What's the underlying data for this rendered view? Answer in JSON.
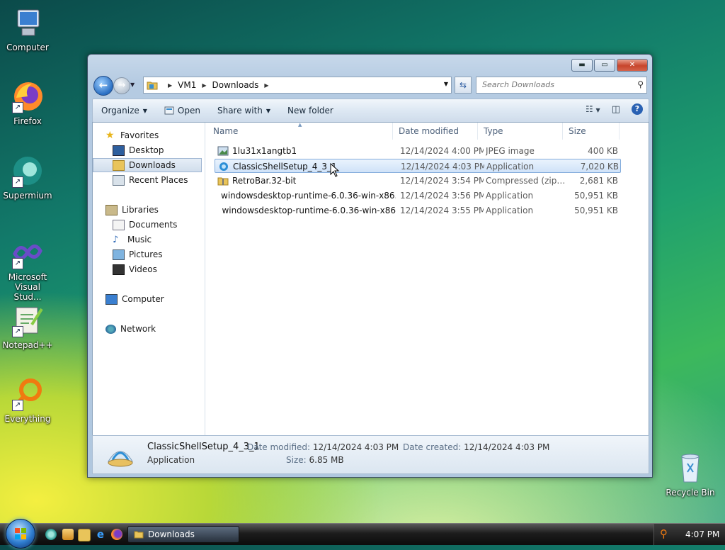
{
  "desktop": {
    "icons": [
      {
        "label": "Computer"
      },
      {
        "label": "Firefox"
      },
      {
        "label": "Supermium"
      },
      {
        "label": "Microsoft Visual Stud..."
      },
      {
        "label": "Notepad++"
      },
      {
        "label": "Everything"
      },
      {
        "label": "Recycle Bin"
      }
    ]
  },
  "window": {
    "address": {
      "parts": [
        "VM1",
        "Downloads"
      ]
    },
    "search": {
      "placeholder": "Search Downloads"
    },
    "toolbar": {
      "organize": "Organize",
      "open": "Open",
      "share": "Share with",
      "new_folder": "New folder"
    },
    "nav": {
      "favorites": "Favorites",
      "desktop": "Desktop",
      "downloads": "Downloads",
      "recent": "Recent Places",
      "libraries": "Libraries",
      "documents": "Documents",
      "music": "Music",
      "pictures": "Pictures",
      "videos": "Videos",
      "computer": "Computer",
      "network": "Network"
    },
    "columns": {
      "name": "Name",
      "date": "Date modified",
      "type": "Type",
      "size": "Size"
    },
    "files": [
      {
        "name": "1lu31x1angtb1",
        "date": "12/14/2024 4:00 PM",
        "type": "JPEG image",
        "size": "400 KB"
      },
      {
        "name": "ClassicShellSetup_4_3_1",
        "date": "12/14/2024 4:03 PM",
        "type": "Application",
        "size": "7,020 KB"
      },
      {
        "name": "RetroBar.32-bit",
        "date": "12/14/2024 3:54 PM",
        "type": "Compressed (zipp...",
        "size": "2,681 KB"
      },
      {
        "name": "windowsdesktop-runtime-6.0.36-win-x86...",
        "date": "12/14/2024 3:56 PM",
        "type": "Application",
        "size": "50,951 KB"
      },
      {
        "name": "windowsdesktop-runtime-6.0.36-win-x86",
        "date": "12/14/2024 3:55 PM",
        "type": "Application",
        "size": "50,951 KB"
      }
    ],
    "details": {
      "name": "ClassicShellSetup_4_3_1",
      "type": "Application",
      "modified_label": "Date modified:",
      "modified": "12/14/2024 4:03 PM",
      "size_label": "Size:",
      "size": "6.85 MB",
      "created_label": "Date created:",
      "created": "12/14/2024 4:03 PM"
    }
  },
  "taskbar": {
    "task": "Downloads",
    "clock": "4:07 PM"
  }
}
